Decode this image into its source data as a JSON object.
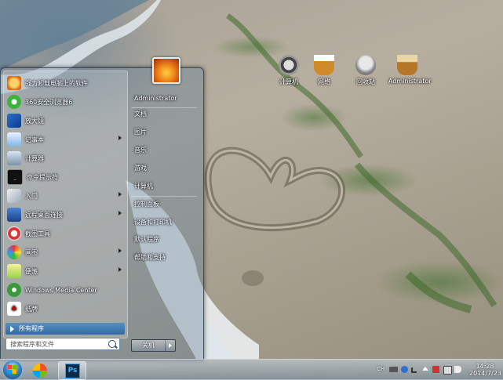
{
  "desktop": {
    "icons": [
      {
        "label": "计算机",
        "icon": "computer-icon"
      },
      {
        "label": "网络",
        "icon": "network-icon"
      },
      {
        "label": "回收站",
        "icon": "recycle-bin-icon"
      },
      {
        "label": "Administrator",
        "icon": "user-folder-icon"
      }
    ]
  },
  "start_menu": {
    "programs": [
      {
        "label": "强力卸载电脑上的软件",
        "icon": "uninstall-icon",
        "submenu": false
      },
      {
        "label": "360安全浏览器6",
        "icon": "browser-360-icon",
        "submenu": false
      },
      {
        "label": "放大镜",
        "icon": "magnifier-icon",
        "submenu": false
      },
      {
        "label": "记事本",
        "icon": "notepad-icon",
        "submenu": true
      },
      {
        "label": "计算器",
        "icon": "calculator-icon",
        "submenu": false
      },
      {
        "label": "命令提示符",
        "icon": "command-prompt-icon",
        "submenu": false
      },
      {
        "label": "入门",
        "icon": "getting-started-icon",
        "submenu": true
      },
      {
        "label": "远程桌面连接",
        "icon": "remote-desktop-icon",
        "submenu": true
      },
      {
        "label": "截图工具",
        "icon": "snipping-tool-icon",
        "submenu": false
      },
      {
        "label": "画图",
        "icon": "paint-icon",
        "submenu": true
      },
      {
        "label": "便笺",
        "icon": "sticky-notes-icon",
        "submenu": true
      },
      {
        "label": "Windows Media Center",
        "icon": "media-center-icon",
        "submenu": false
      },
      {
        "label": "纸牌",
        "icon": "solitaire-icon",
        "submenu": false
      }
    ],
    "all_programs_label": "所有程序",
    "search_placeholder": "搜索程序和文件",
    "right_items": [
      "Administrator",
      "文档",
      "图片",
      "音乐",
      "游戏",
      "计算机",
      "控制面板",
      "设备和打印机",
      "默认程序",
      "帮助和支持"
    ],
    "shutdown_label": "关机"
  },
  "taskbar": {
    "pinned": [
      {
        "name": "start-button"
      },
      {
        "name": "media-player-icon"
      },
      {
        "name": "photoshop-icon",
        "label": "Ps"
      }
    ],
    "tray_text": "CH",
    "clock_time": "14:28",
    "clock_date": "2014/7/23"
  }
}
